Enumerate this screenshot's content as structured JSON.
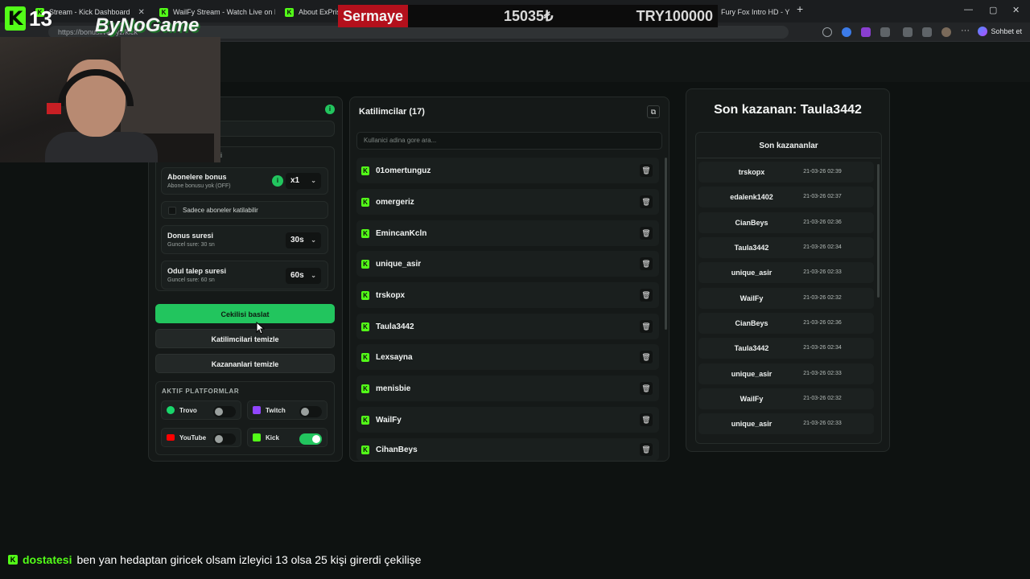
{
  "browser": {
    "tabs": [
      {
        "title": "Stream - Kick Dashboard",
        "close": "✕"
      },
      {
        "title": "WailFy Stream - Watch Live on Kick",
        "close": "✕"
      },
      {
        "title": "About ExPrison",
        "close": "✕"
      },
      {
        "title": "Fury Fox Intro HD - Y",
        "close": "✕"
      }
    ],
    "new_tab": "+",
    "window_controls": [
      "—",
      "▢",
      "✕"
    ],
    "url": "https://bonuslive.xyz/kick",
    "chat_button": "Sohbet et"
  },
  "overlay": {
    "channel_logo_letter": "K",
    "channel_number": "13",
    "brand": "ByNoGame",
    "ticker_label": "Sermaye",
    "ticker_value_1": "15035₺",
    "ticker_value_2": "TRY100000",
    "chat": {
      "logo_letter": "K",
      "user": "dostatesi",
      "message": "ben yan hedaptan giricek olsam izleyici 13 olsa 25 kişi girerdi çekilişe"
    }
  },
  "settings": {
    "info_icon_glyph": "i",
    "section_fragment": "i",
    "subscriber_bonus": {
      "title": "Abonelere bonus",
      "sub": "Abone bonusu yok (OFF)",
      "value": "x1"
    },
    "subscribers_only": "Sadece aboneler katilabilir",
    "spin_time": {
      "title": "Donus suresi",
      "sub": "Guncel sure: 30 sn",
      "value": "30s"
    },
    "claim_time": {
      "title": "Odul talep suresi",
      "sub": "Guncel sure: 60 sn",
      "value": "60s"
    },
    "buttons": {
      "start": "Cekilisi baslat",
      "clear_participants": "Katilimcilari temizle",
      "clear_winners": "Kazananlari temizle"
    },
    "platforms_heading": "AKTIF PLATFORMLAR",
    "platforms": [
      {
        "name": "Trovo",
        "enabled": false,
        "color": "#19d66b"
      },
      {
        "name": "Twitch",
        "enabled": false,
        "color": "#9146ff"
      },
      {
        "name": "YouTube",
        "enabled": false,
        "color": "#ff0000"
      },
      {
        "name": "Kick",
        "enabled": true,
        "color": "#53fc18"
      }
    ]
  },
  "participants": {
    "heading": "Katilimcilar (17)",
    "search_placeholder": "Kullanici adina gore ara...",
    "list": [
      "01omertunguz",
      "omergeriz",
      "EmincanKcln",
      "unique_asir",
      "trskopx",
      "Taula3442",
      "Lexsayna",
      "menisbie",
      "WailFy",
      "CihanBeys"
    ]
  },
  "winners": {
    "last_winner": "Son kazanan: Taula3442",
    "recent_heading": "Son kazananlar",
    "list": [
      {
        "name": "trskopx",
        "time": "21-03-26 02:39"
      },
      {
        "name": "edalenk1402",
        "time": "21-03-26 02:37"
      },
      {
        "name": "CianBeys",
        "time": "21-03-26 02:36"
      },
      {
        "name": "Taula3442",
        "time": "21-03-26 02:34"
      },
      {
        "name": "unique_asir",
        "time": "21-03-26 02:33"
      },
      {
        "name": "WailFy",
        "time": "21-03-26 02:32"
      },
      {
        "name": "CianBeys",
        "time": "21-03-26 02:36"
      },
      {
        "name": "Taula3442",
        "time": "21-03-26 02:34"
      },
      {
        "name": "unique_asir",
        "time": "21-03-26 02:33"
      },
      {
        "name": "WailFy",
        "time": "21-03-26 02:32"
      },
      {
        "name": "unique_asir",
        "time": "21-03-26 02:33"
      }
    ]
  },
  "colors": {
    "accent": "#22c55e",
    "kick": "#53fc18",
    "background": "#0e1211"
  }
}
